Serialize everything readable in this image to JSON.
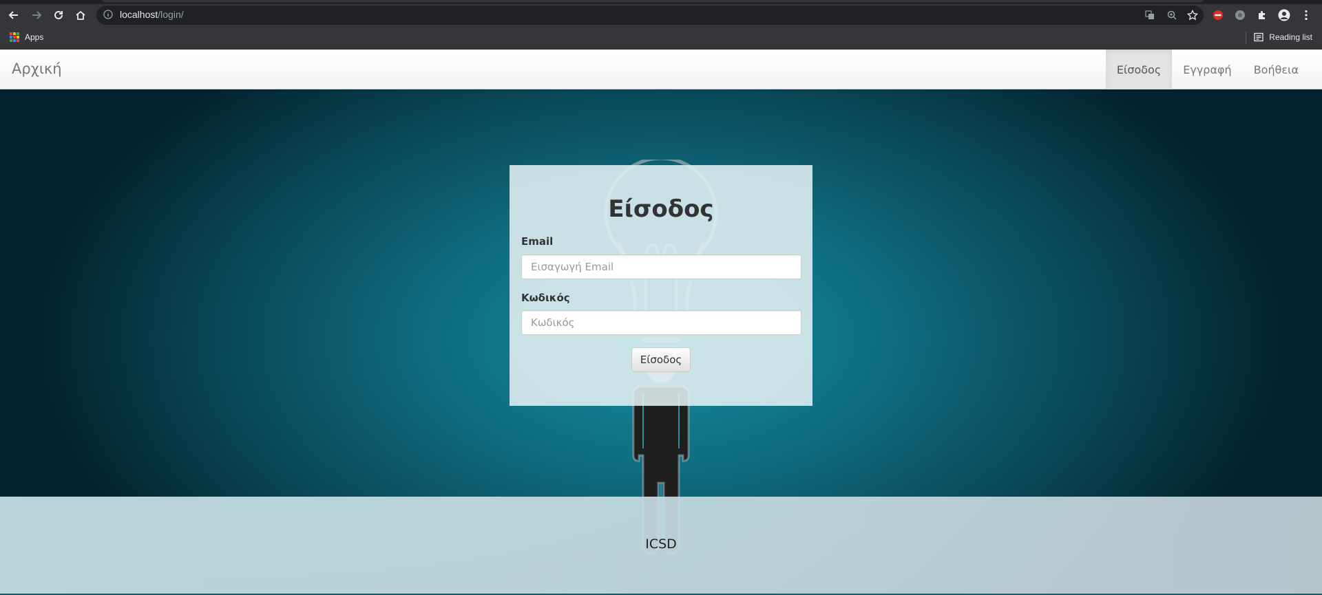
{
  "browser": {
    "url_host": "localhost",
    "url_path": "/login/",
    "bookmarks": {
      "apps_label": "Apps",
      "reading_list_label": "Reading list"
    }
  },
  "navbar": {
    "brand": "Αρχική",
    "items": [
      {
        "label": "Είσοδος",
        "active": true
      },
      {
        "label": "Εγγραφή",
        "active": false
      },
      {
        "label": "Βοήθεια",
        "active": false
      }
    ]
  },
  "login": {
    "title": "Είσοδος",
    "email_label": "Email",
    "email_placeholder": "Εισαγωγή Email",
    "password_label": "Κωδικός",
    "password_placeholder": "Κωδικός",
    "submit_label": "Είσοδος"
  },
  "footer": {
    "text": "ICSD"
  },
  "colors": {
    "accent_teal": "#178ea3",
    "background_dark": "#052430"
  }
}
